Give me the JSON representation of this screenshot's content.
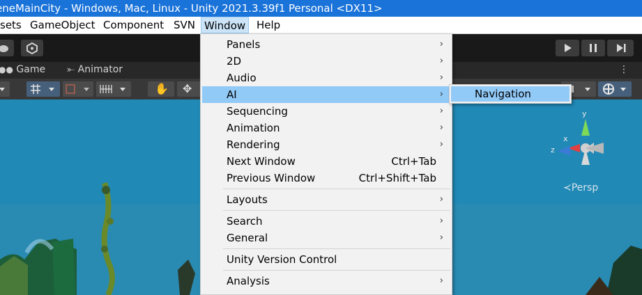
{
  "window": {
    "title": "eneMainCity - Windows, Mac, Linux - Unity 2021.3.39f1 Personal <DX11>"
  },
  "menubar": {
    "items": [
      {
        "label": "sets"
      },
      {
        "label": "GameObject"
      },
      {
        "label": "Component"
      },
      {
        "label": "SVN"
      },
      {
        "label": "Window"
      },
      {
        "label": "Help"
      }
    ]
  },
  "tabs": [
    {
      "label": "Game"
    },
    {
      "label": "Animator"
    }
  ],
  "window_menu": {
    "items": [
      {
        "label": "Panels",
        "submenu": true
      },
      {
        "label": "2D",
        "submenu": true
      },
      {
        "label": "Audio",
        "submenu": true
      },
      {
        "label": "AI",
        "submenu": true,
        "highlighted": true
      },
      {
        "label": "Sequencing",
        "submenu": true
      },
      {
        "label": "Animation",
        "submenu": true
      },
      {
        "label": "Rendering",
        "submenu": true
      },
      {
        "label": "Next Window",
        "shortcut": "Ctrl+Tab"
      },
      {
        "label": "Previous Window",
        "shortcut": "Ctrl+Shift+Tab"
      },
      {
        "label": "Layouts",
        "submenu": true
      },
      {
        "label": "Search",
        "submenu": true
      },
      {
        "label": "General",
        "submenu": true
      },
      {
        "label": "Unity Version Control"
      },
      {
        "label": "Analysis",
        "submenu": true
      }
    ]
  },
  "ai_submenu": {
    "items": [
      {
        "label": "Navigation"
      }
    ]
  },
  "gizmo": {
    "x": "x",
    "y": "y",
    "z": "z",
    "persp": "Persp"
  },
  "colors": {
    "title_bar": "#1a73d9",
    "highlight": "#91c9f7",
    "menu_bg": "#f2f2f2"
  }
}
